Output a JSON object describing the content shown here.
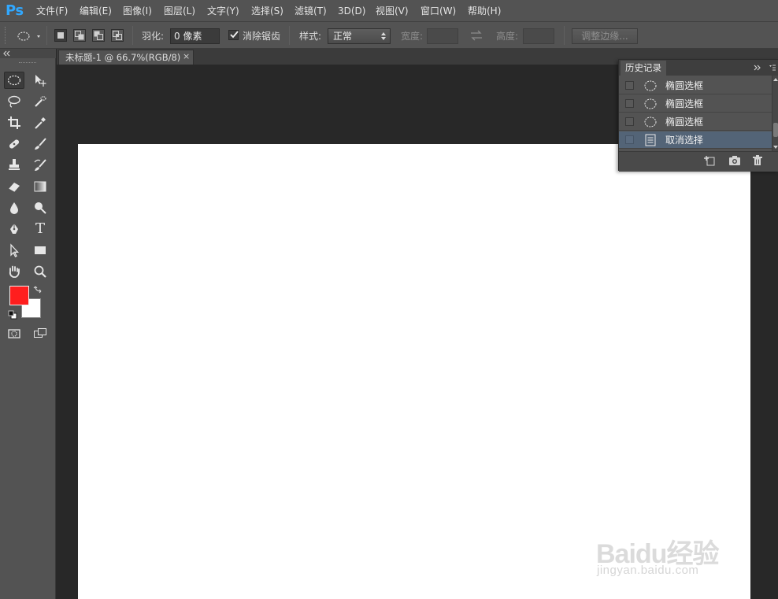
{
  "app": {
    "logo": "Ps",
    "menu": [
      "文件(F)",
      "编辑(E)",
      "图像(I)",
      "图层(L)",
      "文字(Y)",
      "选择(S)",
      "滤镜(T)",
      "3D(D)",
      "视图(V)",
      "窗口(W)",
      "帮助(H)"
    ]
  },
  "options": {
    "feather_label": "羽化:",
    "feather_value": "0 像素",
    "antialias_label": "消除锯齿",
    "antialias_checked": true,
    "style_label": "样式:",
    "style_value": "正常",
    "width_label": "宽度:",
    "height_label": "高度:",
    "refine_edge_label": "调整边缘..."
  },
  "document": {
    "tab_title": "未标题-1 @ 66.7%(RGB/8)",
    "close_glyph": "×"
  },
  "colors": {
    "foreground": "#ff1e1e",
    "background": "#ffffff"
  },
  "tools": [
    "elliptical-marquee",
    "move",
    "lasso",
    "quick-selection",
    "crop",
    "eyedropper",
    "spot-healing-brush",
    "brush",
    "clone-stamp",
    "history-brush",
    "eraser",
    "gradient",
    "blur",
    "dodge",
    "pen",
    "type",
    "path-selection",
    "rectangle",
    "hand",
    "zoom",
    "quick-mask",
    "screen-mode"
  ],
  "type_tool_glyph": "T",
  "history": {
    "title": "历史记录",
    "items": [
      {
        "label": "椭圆选框",
        "icon": "ellipse-icon",
        "selected": false
      },
      {
        "label": "椭圆选框",
        "icon": "ellipse-icon",
        "selected": false
      },
      {
        "label": "椭圆选框",
        "icon": "ellipse-icon",
        "selected": false
      },
      {
        "label": "取消选择",
        "icon": "document-icon",
        "selected": true
      }
    ]
  },
  "watermark": {
    "logo_text": "Baidu经验",
    "url": "jingyan.baidu.com"
  }
}
